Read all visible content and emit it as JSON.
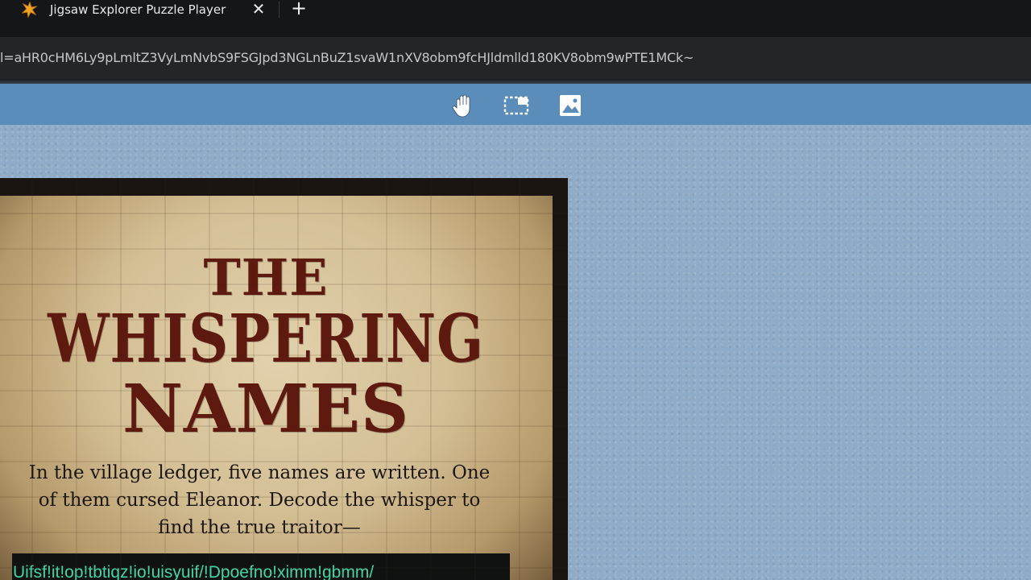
{
  "browser": {
    "tab_title": "Jigsaw Explorer Puzzle Player",
    "tab_close": "✕",
    "new_tab": "+",
    "url": "l=aHR0cHM6Ly9pLmltZ3VyLmNvbS9FSGJpd3NGLnBuZ1svaW1nXV8obm9fcHJldmlld180KV8obm9wPTE1MCk~"
  },
  "toolbar": {
    "tools": [
      {
        "name": "pan-hand-icon"
      },
      {
        "name": "selection-rectangle-icon"
      },
      {
        "name": "image-preview-icon"
      }
    ]
  },
  "puzzle": {
    "title_line1": "THE",
    "title_line2": "WHISPERING",
    "title_line3": "NAMES",
    "body": "In the village ledger, five names are written. One of them cursed Eleanor. Decode the whisper to find the true traitor—",
    "cipher": "Uifsf!it!op!tbtiqz!io!uisyuif/!Dpoefno!ximm!gbmm/"
  },
  "colors": {
    "toolbar": "#5b8dbb",
    "workspace": "#8eabc7",
    "title_red": "#5e1a0f",
    "cipher_green": "#3fd6a8"
  }
}
